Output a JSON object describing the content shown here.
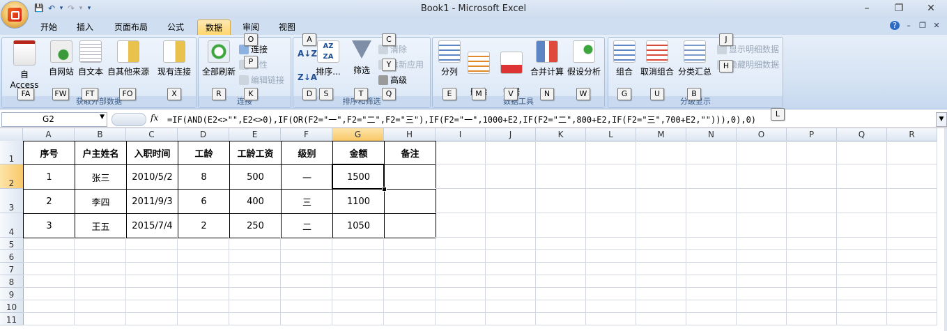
{
  "window": {
    "title": "Book1 - Microsoft Excel",
    "controls": [
      "–",
      "❐",
      "✕"
    ]
  },
  "qat": {
    "save": "💾",
    "undo": "↶",
    "undo_dd": "▾",
    "redo": "↷",
    "redo_dd": "▾",
    "customize": "▾"
  },
  "tabs": [
    "开始",
    "插入",
    "页面布局",
    "公式",
    "数据",
    "审阅",
    "视图"
  ],
  "active_tab": "数据",
  "tab_right_icons": [
    "?",
    "–",
    "❐",
    "✕"
  ],
  "ribbon": {
    "get_external": {
      "label": "获取外部数据",
      "buttons": [
        "自 Access",
        "自网站",
        "自文本",
        "自其他来源",
        "现有连接"
      ]
    },
    "connections": {
      "label": "连接",
      "refresh": "全部刷新",
      "small": [
        "连接",
        "属性",
        "编辑链接"
      ]
    },
    "sort_filter": {
      "label": "排序和筛选",
      "sort": "排序...",
      "filter": "筛选",
      "small": [
        "清除",
        "重新应用",
        "高级"
      ]
    },
    "data_tools": {
      "label": "数据工具",
      "buttons": [
        "分列",
        "删除\n重复项",
        "数据\n有效性",
        "合并计算",
        "假设分析"
      ]
    },
    "outline": {
      "label": "分级显示",
      "buttons": [
        "组合",
        "取消组合",
        "分类汇总"
      ],
      "small": [
        "显示明细数据",
        "隐藏明细数据"
      ]
    }
  },
  "keytips": {
    "FA": "FA",
    "FW": "FW",
    "FT": "FT",
    "FO": "FO",
    "X": "X",
    "R": "R",
    "O": "O",
    "P": "P",
    "K": "K",
    "A": "A",
    "D": "D",
    "S": "S",
    "T": "T",
    "C": "C",
    "Y": "Y",
    "Q": "Q",
    "E": "E",
    "M": "M",
    "V": "V",
    "N": "N",
    "W": "W",
    "G": "G",
    "U": "U",
    "B": "B",
    "J": "J",
    "H": "H",
    "L": "L"
  },
  "formula_bar": {
    "name_box": "G2",
    "fx": "fx",
    "formula": "=IF(AND(E2<>\"\",E2<>0),IF(OR(F2=\"一\",F2=\"二\",F2=\"三\"),IF(F2=\"一\",1000+E2,IF(F2=\"二\",800+E2,IF(F2=\"三\",700+E2,\"\"))),0),0)"
  },
  "columns": [
    "A",
    "B",
    "C",
    "D",
    "E",
    "F",
    "G",
    "H",
    "I",
    "J",
    "K",
    "L",
    "M",
    "N",
    "O",
    "P",
    "Q",
    "R"
  ],
  "rows": [
    "1",
    "2",
    "3",
    "4",
    "5",
    "6",
    "7",
    "8",
    "9",
    "10",
    "11"
  ],
  "table": {
    "headers": [
      "序号",
      "户主姓名",
      "入职时间",
      "工龄",
      "工龄工资",
      "级别",
      "金额",
      "备注"
    ],
    "rows": [
      [
        "1",
        "张三",
        "2010/5/2",
        "8",
        "500",
        "一",
        "1500",
        ""
      ],
      [
        "2",
        "李四",
        "2011/9/3",
        "6",
        "400",
        "三",
        "1100",
        ""
      ],
      [
        "3",
        "王五",
        "2015/7/4",
        "2",
        "250",
        "二",
        "1050",
        ""
      ]
    ]
  },
  "active_cell": "G2"
}
